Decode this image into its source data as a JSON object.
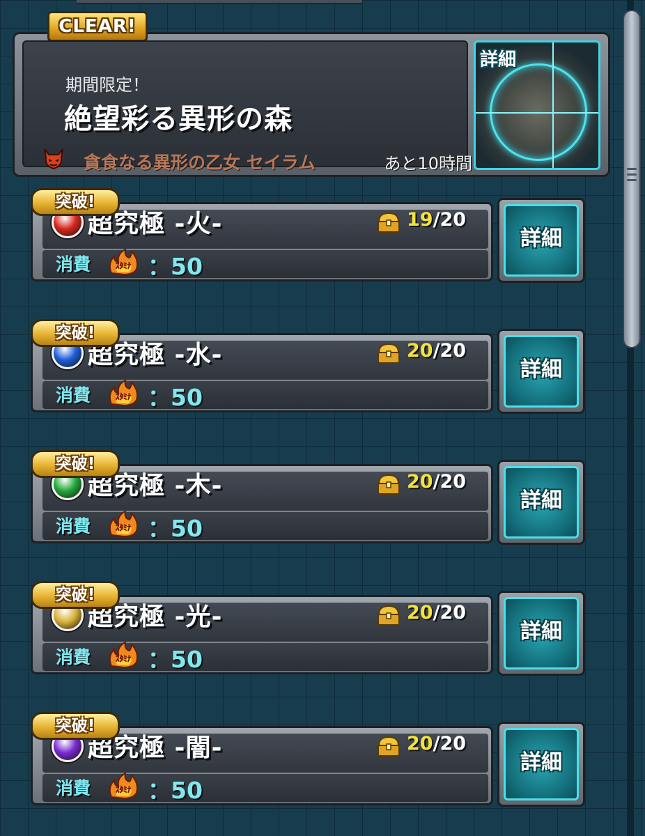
{
  "banner": {
    "clear_badge": "CLEAR!",
    "subtitle": "期間限定！",
    "title": "絶望彩る異形の森",
    "boss_icon": "devil-icon",
    "boss_name": "貪食なる異形の乙女 セイラム",
    "time_left": "あと10時間",
    "detail_label": "詳細"
  },
  "quests": [
    {
      "badge": "突破!",
      "element": "fire",
      "element_color": "#d8281e",
      "name": "超究極 ‐火‐",
      "count_done": "19",
      "count_total": "/20",
      "stamina_label": "消費",
      "stamina_icon_text": "ｽﾀﾐﾅ",
      "stamina_value": "：50",
      "detail_label": "詳細"
    },
    {
      "badge": "突破!",
      "element": "water",
      "element_color": "#1e5ed8",
      "name": "超究極 ‐水‐",
      "count_done": "20",
      "count_total": "/20",
      "stamina_label": "消費",
      "stamina_icon_text": "ｽﾀﾐﾅ",
      "stamina_value": "：50",
      "detail_label": "詳細"
    },
    {
      "badge": "突破!",
      "element": "wood",
      "element_color": "#22a83a",
      "name": "超究極 ‐木‐",
      "count_done": "20",
      "count_total": "/20",
      "stamina_label": "消費",
      "stamina_icon_text": "ｽﾀﾐﾅ",
      "stamina_value": "：50",
      "detail_label": "詳細"
    },
    {
      "badge": "突破!",
      "element": "light",
      "element_color": "#d9b23a",
      "name": "超究極 ‐光‐",
      "count_done": "20",
      "count_total": "/20",
      "stamina_label": "消費",
      "stamina_icon_text": "ｽﾀﾐﾅ",
      "stamina_value": "：50",
      "detail_label": "詳細"
    },
    {
      "badge": "突破!",
      "element": "dark",
      "element_color": "#7a2ad0",
      "name": "超究極 ‐闇‐",
      "count_done": "20",
      "count_total": "/20",
      "stamina_label": "消費",
      "stamina_icon_text": "ｽﾀﾐﾅ",
      "stamina_value": "：50",
      "detail_label": "詳細"
    }
  ],
  "colors": {
    "accent_cyan": "#3ad6e6",
    "gold": "#e7b332",
    "count_done": "#f4e23c",
    "stamina_text": "#7fe8f0"
  }
}
